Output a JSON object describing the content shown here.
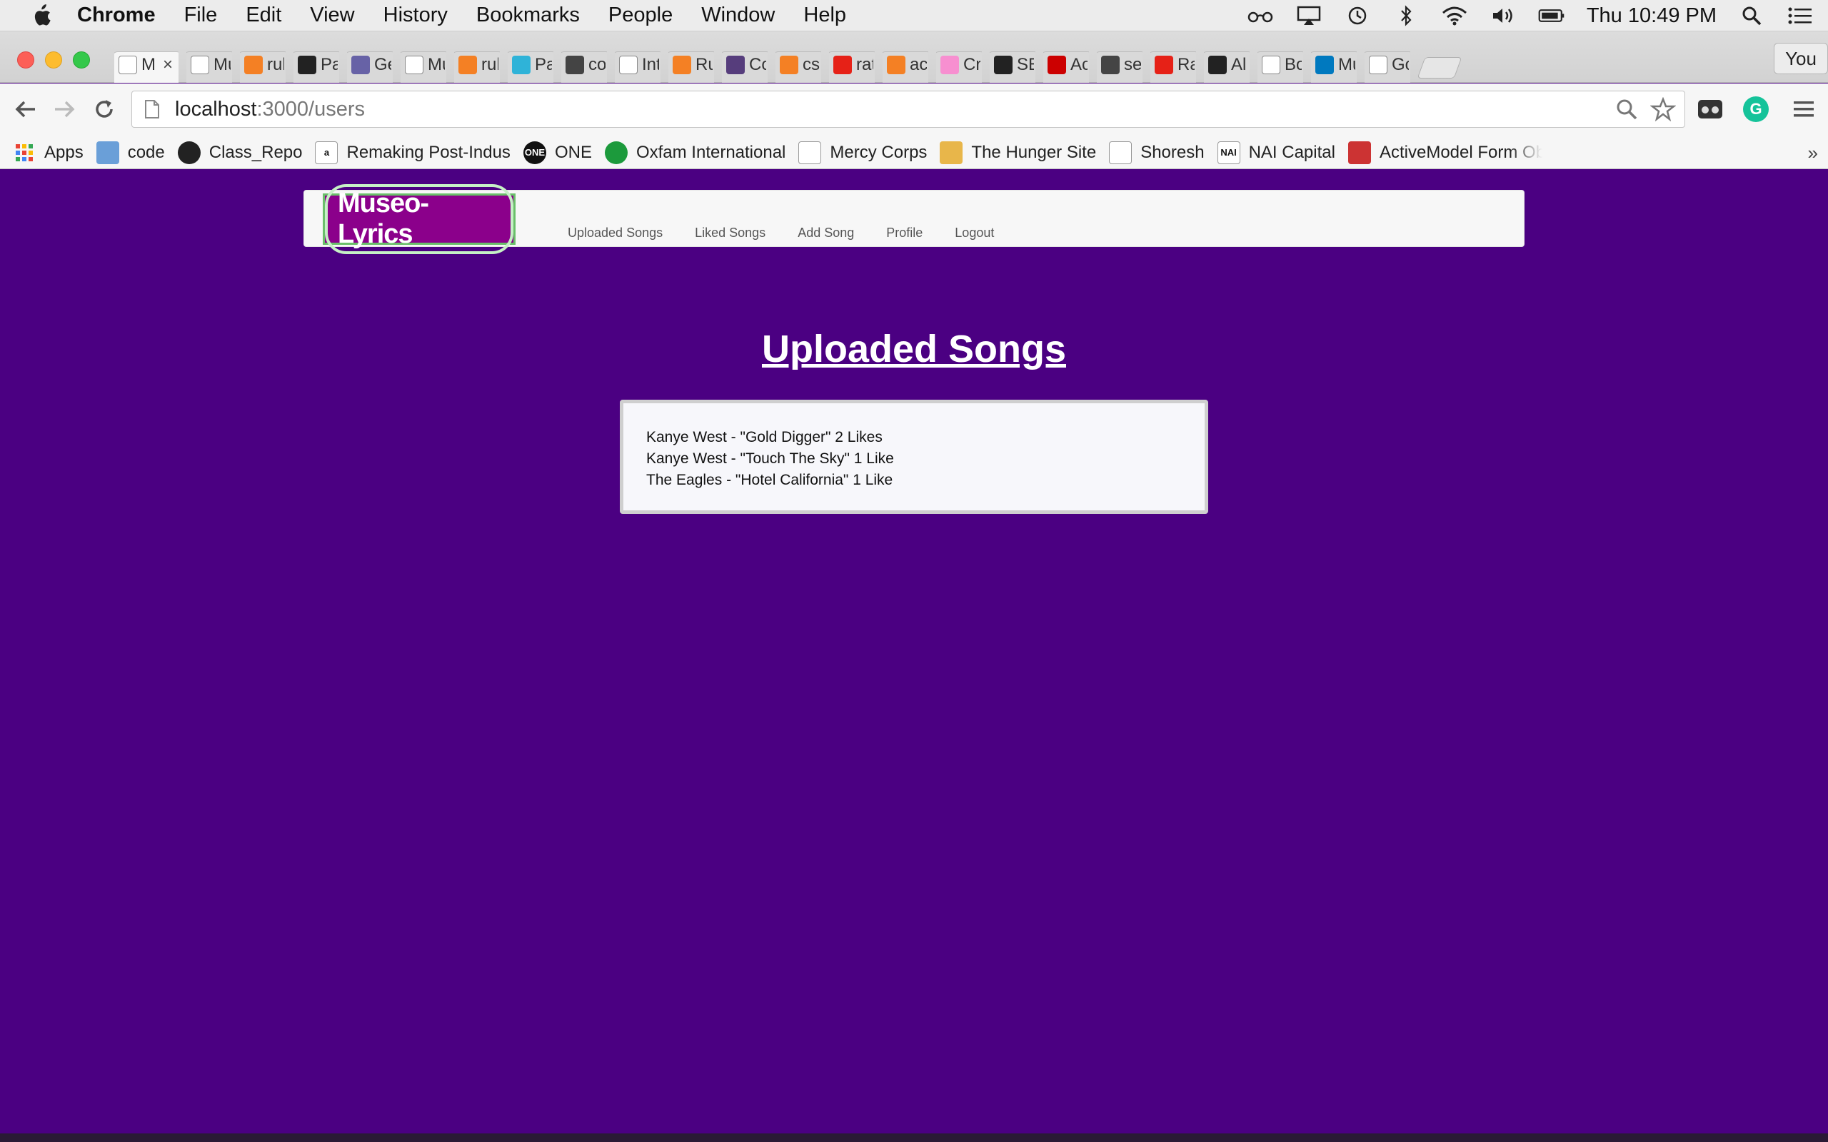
{
  "menubar": {
    "app_name": "Chrome",
    "items": [
      "File",
      "Edit",
      "View",
      "History",
      "Bookmarks",
      "People",
      "Window",
      "Help"
    ],
    "clock": "Thu 10:49 PM"
  },
  "tabs": [
    {
      "label": "M",
      "active": true,
      "favicon": "page-icon"
    },
    {
      "label": "Mu",
      "favicon": "page-icon"
    },
    {
      "label": "rul",
      "favicon": "stackoverflow-icon"
    },
    {
      "label": "Pa",
      "favicon": "github-icon"
    },
    {
      "label": "Ge",
      "favicon": "heroku-icon"
    },
    {
      "label": "Mu",
      "favicon": "page-icon"
    },
    {
      "label": "rul",
      "favicon": "stackoverflow-icon"
    },
    {
      "label": "Pa",
      "favicon": "doc-icon"
    },
    {
      "label": "co",
      "favicon": "dock-icon"
    },
    {
      "label": "Int",
      "favicon": "gmail-icon"
    },
    {
      "label": "Ru",
      "favicon": "stackoverflow-icon"
    },
    {
      "label": "Co",
      "favicon": "bootstrap-icon"
    },
    {
      "label": "cs",
      "favicon": "stackoverflow-icon"
    },
    {
      "label": "rat",
      "favicon": "youtube-icon"
    },
    {
      "label": "ac",
      "favicon": "stackoverflow-icon"
    },
    {
      "label": "Cr",
      "favicon": "heart-icon"
    },
    {
      "label": "SE",
      "favicon": "github-icon"
    },
    {
      "label": "Ac",
      "favicon": "ruby-icon"
    },
    {
      "label": "se",
      "favicon": "dock-icon"
    },
    {
      "label": "Ra",
      "favicon": "youtube-icon"
    },
    {
      "label": "Al",
      "favicon": "github-icon"
    },
    {
      "label": "Bo",
      "favicon": "diamond-icon"
    },
    {
      "label": "Mu",
      "favicon": "trello-icon"
    },
    {
      "label": "Go",
      "favicon": "google-icon"
    }
  ],
  "profile_button": "You",
  "address": {
    "host": "localhost",
    "path": ":3000/users"
  },
  "bookmarks": [
    {
      "label": "Apps",
      "icon": "apps-grid-icon"
    },
    {
      "label": "code",
      "icon": "folder-icon"
    },
    {
      "label": "Class_Repo",
      "icon": "github-icon"
    },
    {
      "label": "Remaking Post-Indus",
      "icon": "amazon-icon"
    },
    {
      "label": "ONE",
      "icon": "one-icon"
    },
    {
      "label": "Oxfam International",
      "icon": "oxfam-icon"
    },
    {
      "label": "Mercy Corps",
      "icon": "page-icon"
    },
    {
      "label": "The Hunger Site",
      "icon": "hunger-site-icon"
    },
    {
      "label": "Shoresh",
      "icon": "page-icon"
    },
    {
      "label": "NAI Capital",
      "icon": "nai-icon"
    },
    {
      "label": "ActiveModel Form Ob",
      "icon": "rails-icon"
    }
  ],
  "site": {
    "brand": "Museo-Lyrics",
    "nav": [
      "Uploaded Songs",
      "Liked Songs",
      "Add Song",
      "Profile",
      "Logout"
    ],
    "heading": "Uploaded Songs",
    "songs": [
      "Kanye West - \"Gold Digger\" 2 Likes",
      "Kanye West - \"Touch The Sky\" 1 Like",
      "The Eagles - \"Hotel California\" 1 Like"
    ]
  },
  "colors": {
    "page_bg": "#4b0082",
    "brand_bg": "#8b008b",
    "brand_border": "#6abf6a"
  }
}
